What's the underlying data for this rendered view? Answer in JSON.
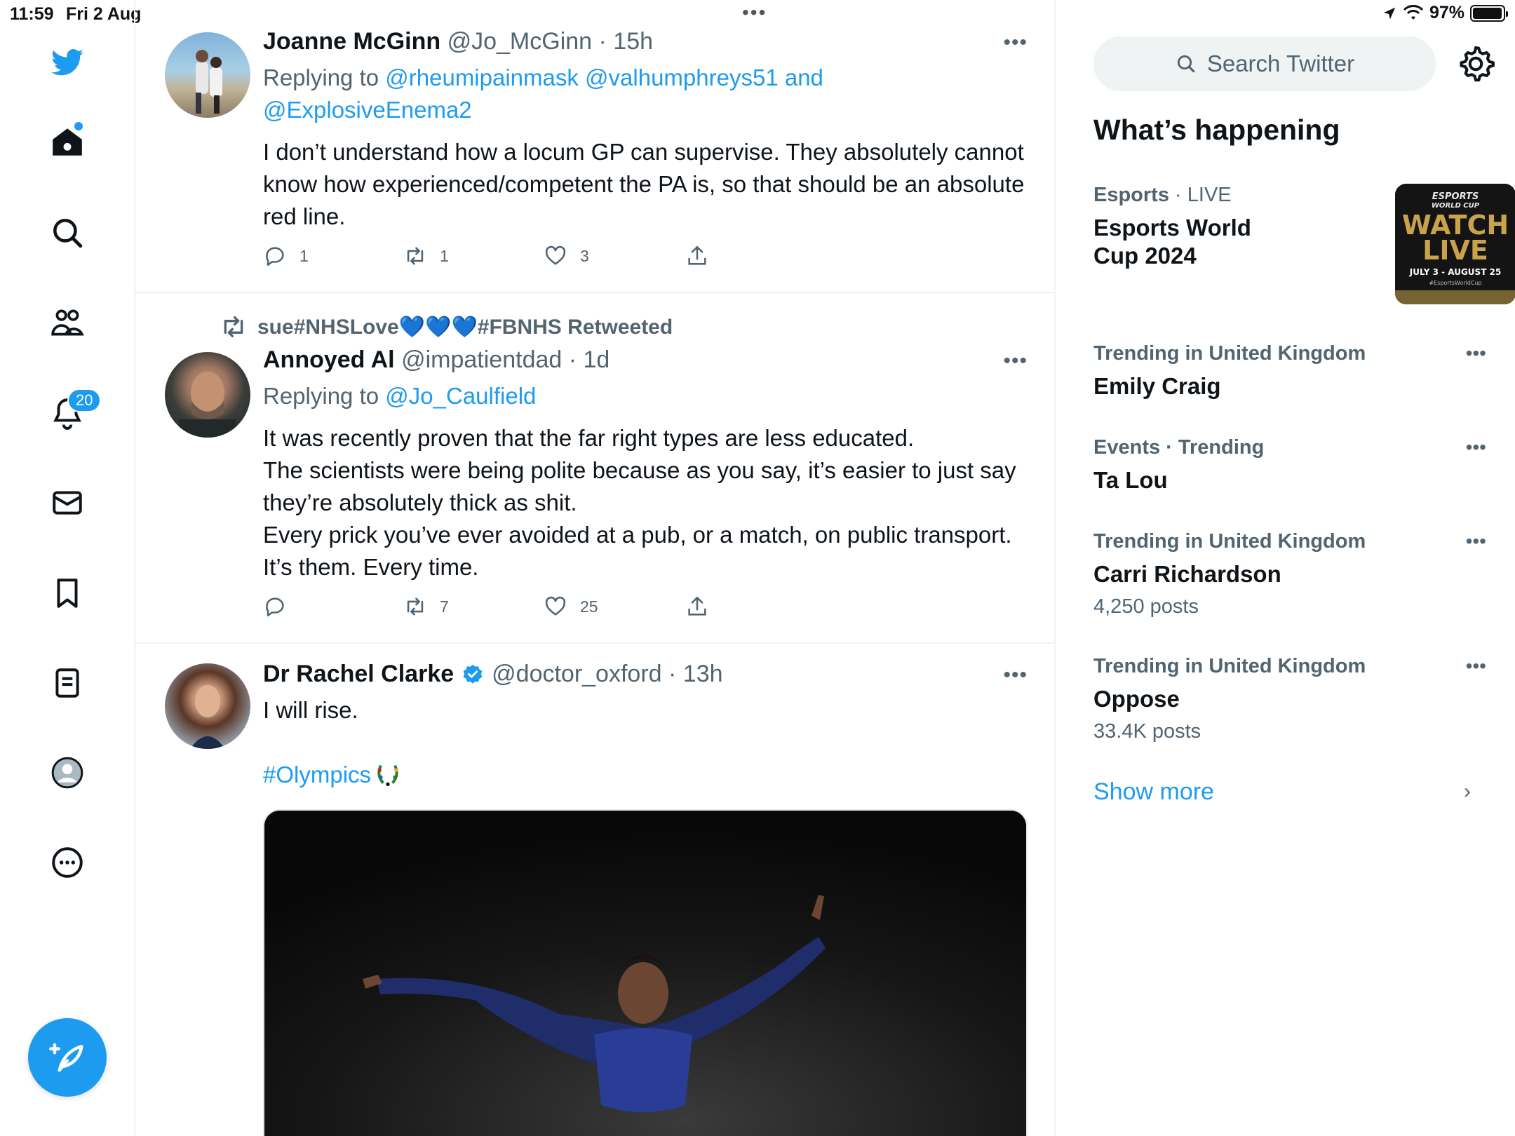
{
  "status_bar": {
    "time": "11:59",
    "date": "Fri 2 Aug",
    "battery": "97%",
    "battery_level": 0.97
  },
  "sidebar": {
    "notifications_badge": "20"
  },
  "tweets": [
    {
      "name": "Joanne McGinn",
      "handle": "@Jo_McGinn",
      "time": "15h",
      "replying_prefix": "Replying to ",
      "replying_to": "@rheumipainmask @valhumphreys51 and @ExplosiveEnema2",
      "text": "I don’t understand how a locum GP can supervise. They absolutely cannot know how experienced/competent the PA is, so that should be an absolute red line.",
      "replies": "1",
      "retweets": "1",
      "likes": "3"
    },
    {
      "retweeted_by": "sue#NHSLove💙💙💙#FBNHS Retweeted",
      "name": "Annoyed Al",
      "handle": "@impatientdad",
      "time": "1d",
      "replying_prefix": "Replying to ",
      "replying_to": "@Jo_Caulfield",
      "text": "It was recently proven that the far right types are less educated.\nThe scientists were being polite because as you say, it’s easier to just say they’re absolutely thick as shit.\nEvery prick you’ve ever avoided at a pub, or a match, on public transport. It’s them. Every time.",
      "replies": "",
      "retweets": "7",
      "likes": "25"
    },
    {
      "name": "Dr Rachel Clarke",
      "handle": "@doctor_oxford",
      "time": "13h",
      "text": "I will rise.",
      "hashtag": "#Olympics"
    }
  ],
  "right": {
    "search_placeholder": "Search Twitter",
    "whats_happening": "What’s happening",
    "trends": [
      {
        "category_bold": "Esports",
        "category_rest": " · LIVE",
        "name": "Esports World Cup 2024",
        "count": ""
      },
      {
        "category_bold": "Trending in United Kingdom",
        "category_rest": "",
        "name": "Emily Craig",
        "count": ""
      },
      {
        "category_bold": "Events · Trending",
        "category_rest": "",
        "name": "Ta Lou",
        "count": ""
      },
      {
        "category_bold": "Trending in United Kingdom",
        "category_rest": "",
        "name": "Carri Richardson",
        "count": "4,250 posts"
      },
      {
        "category_bold": "Trending in United Kingdom",
        "category_rest": "",
        "name": "Oppose",
        "count": "33.4K posts"
      }
    ],
    "esports_thumb": {
      "line1": "ESPORTS",
      "line2": "WORLD CUP",
      "line3": "WATCH",
      "line4": "LIVE",
      "line5": "JULY 3 - AUGUST 25",
      "line6": "#EsportsWorldCup"
    },
    "show_more": "Show more"
  },
  "colors": {
    "accent": "#1d9bf0",
    "text": "#0f1419",
    "muted": "#536471"
  }
}
